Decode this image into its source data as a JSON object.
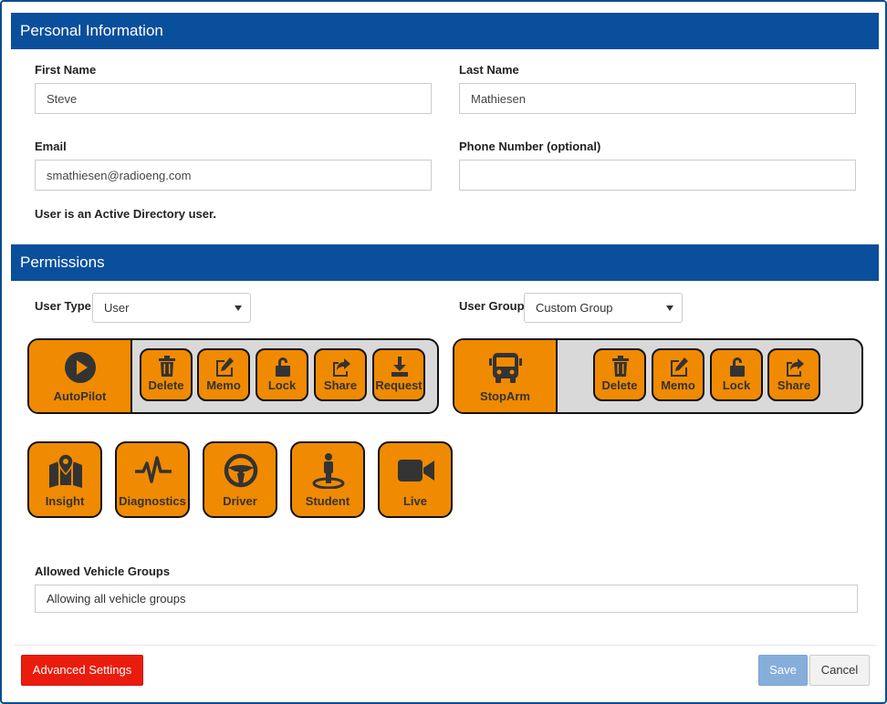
{
  "personal": {
    "header": "Personal Information",
    "first_name_label": "First Name",
    "first_name_value": "Steve",
    "last_name_label": "Last Name",
    "last_name_value": "Mathiesen",
    "email_label": "Email",
    "email_value": "smathiesen@radioeng.com",
    "phone_label": "Phone Number (optional)",
    "phone_value": "",
    "ad_note": "User is an Active Directory user."
  },
  "permissions": {
    "header": "Permissions",
    "user_type_label": "User Type",
    "user_type_value": "User",
    "user_group_label": "User Group",
    "user_group_value": "Custom Group",
    "autopilot": {
      "label": "AutoPilot",
      "actions": [
        "Delete",
        "Memo",
        "Lock",
        "Share",
        "Request"
      ]
    },
    "stoparm": {
      "label": "StopArm",
      "actions": [
        "Delete",
        "Memo",
        "Lock",
        "Share"
      ]
    },
    "features": [
      "Insight",
      "Diagnostics",
      "Driver",
      "Student",
      "Live"
    ],
    "vehicle_groups_label": "Allowed Vehicle Groups",
    "vehicle_groups_value": "Allowing all vehicle groups"
  },
  "footer": {
    "advanced_label": "Advanced Settings",
    "save_label": "Save",
    "cancel_label": "Cancel"
  },
  "colors": {
    "header_blue": "#0a4f9c",
    "permission_orange": "#f08a00",
    "advanced_red": "#ea1c0d",
    "save_blue": "#86aedb"
  }
}
